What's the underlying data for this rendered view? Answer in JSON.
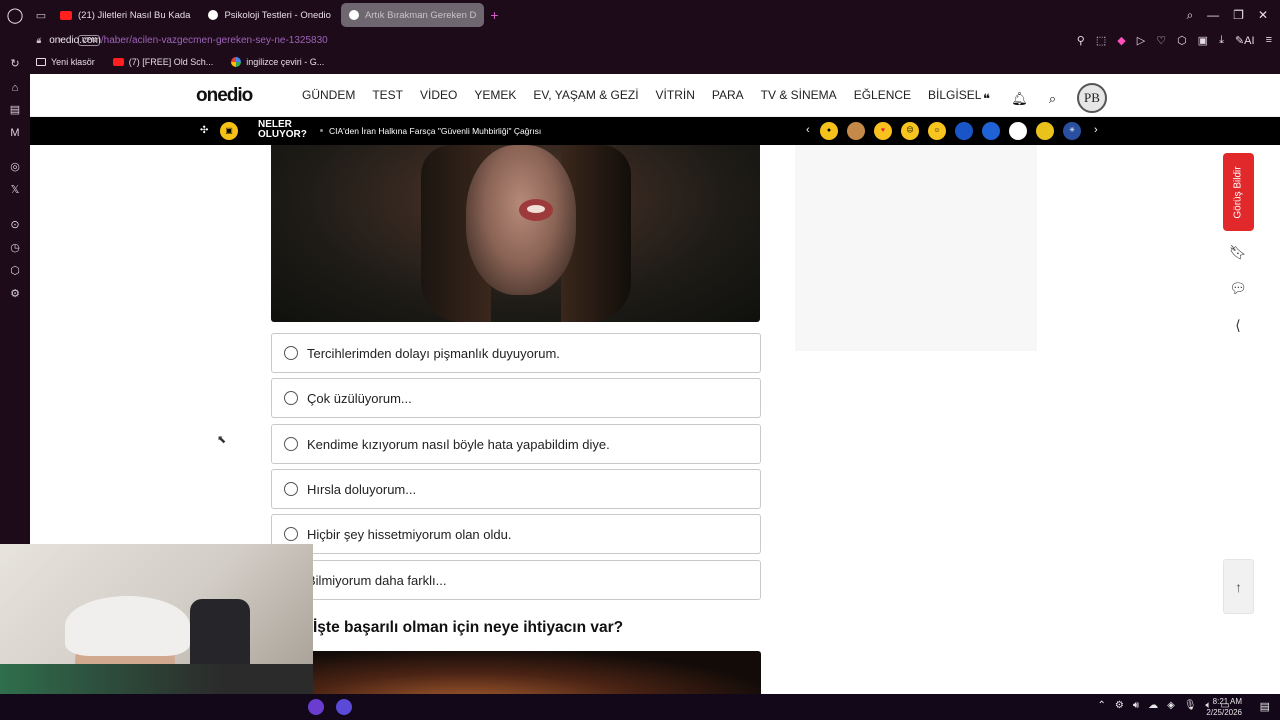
{
  "browser": {
    "tabs": [
      {
        "label": "(21) Jiletleri Nasıl Bu Kada",
        "kind": "yt",
        "active": false
      },
      {
        "label": "Psikoloji Testleri - Onedio",
        "kind": "od",
        "active": false
      },
      {
        "label": "Artık Bırakman Gereken D",
        "kind": "od",
        "active": true
      }
    ],
    "url_host": "onedio.com",
    "url_path": "/haber/acilen-vazgecmen-gereken-sey-ne-1325830",
    "vpn_label": "VPN",
    "ai_label": "AI",
    "bookmarks": [
      {
        "label": "Yeni klasör",
        "kind": "folder"
      },
      {
        "label": "(7) [FREE] Old Sch...",
        "kind": "yt"
      },
      {
        "label": "ingilizce çeviri - G...",
        "kind": "g"
      }
    ]
  },
  "site": {
    "logo": "onedio",
    "nav": [
      "GÜNDEM",
      "TEST",
      "VİDEO",
      "YEMEK",
      "EV, YAŞAM & GEZİ",
      "VİTRİN",
      "PARA",
      "TV & SİNEMA",
      "EĞLENCE",
      "BİLGİSEL"
    ],
    "avatar_initials": "PB"
  },
  "ticker": {
    "title": "NELER OLUYOR?",
    "headline": "CIA'den İran Halkına Farsça \"Güvenli Muhbirliği\" Çağrısı"
  },
  "quiz": {
    "options": [
      "Tercihlerimden dolayı pişmanlık duyuyorum.",
      "Çok üzülüyorum...",
      "Kendime kızıyorum nasıl böyle hata yapabildim diye.",
      "Hırsla doluyorum...",
      "Hiçbir şey hissetmiyorum olan oldu.",
      "Bilmiyorum daha farklı..."
    ],
    "next_question": "İşte başarılı olman için neye ihtiyacın var?"
  },
  "side": {
    "feedback_label": "Görüş Bildir"
  },
  "taskbar": {
    "time": "8:21 AM",
    "date": "2/25/2026"
  }
}
